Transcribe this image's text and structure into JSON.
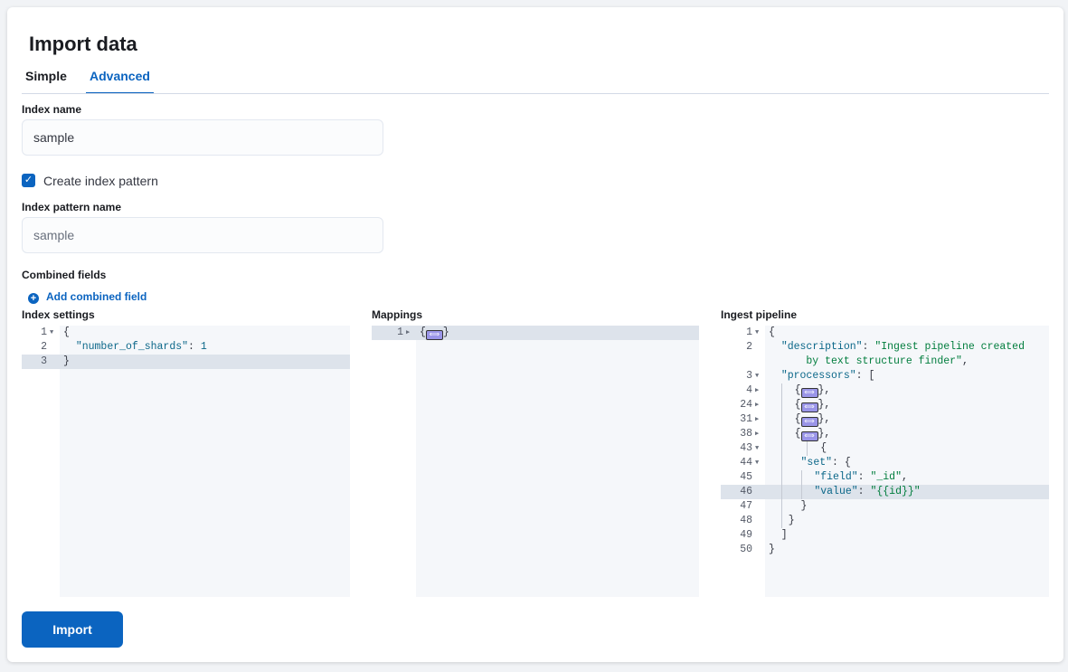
{
  "title": "Import data",
  "tabs": [
    {
      "label": "Simple",
      "active": false
    },
    {
      "label": "Advanced",
      "active": true
    }
  ],
  "index_name": {
    "label": "Index name",
    "value": "sample"
  },
  "create_index_pattern": {
    "label": "Create index pattern",
    "checked": true
  },
  "index_pattern_name": {
    "label": "Index pattern name",
    "value": "sample"
  },
  "combined_fields": {
    "label": "Combined fields",
    "add_label": "Add combined field"
  },
  "editors": [
    {
      "label": "Index settings",
      "lines": [
        {
          "n": "1",
          "fold": "open",
          "c": [
            [
              "p",
              "{"
            ]
          ]
        },
        {
          "n": "2",
          "c": [
            [
              "p",
              "  "
            ],
            [
              "k",
              "\"number_of_shards\""
            ],
            [
              "p",
              ": "
            ],
            [
              "n",
              "1"
            ]
          ]
        },
        {
          "n": "3",
          "hl": true,
          "c": [
            [
              "p",
              "}"
            ]
          ]
        }
      ]
    },
    {
      "label": "Mappings",
      "lines": [
        {
          "n": "1",
          "fold": "closed",
          "hl": true,
          "c": [
            [
              "p",
              "{"
            ],
            [
              "fw",
              ""
            ],
            [
              "p",
              "}"
            ]
          ]
        }
      ]
    },
    {
      "label": "Ingest pipeline",
      "lines": [
        {
          "n": "1",
          "fold": "open",
          "c": [
            [
              "p",
              "{"
            ]
          ]
        },
        {
          "n": "2",
          "c": [
            [
              "p",
              "  "
            ],
            [
              "k",
              "\"description\""
            ],
            [
              "p",
              ": "
            ],
            [
              "s",
              "\"Ingest pipeline created"
            ]
          ]
        },
        {
          "n": "",
          "c": [
            [
              "s",
              "      by text structure finder\""
            ],
            [
              "p",
              ","
            ]
          ]
        },
        {
          "n": "3",
          "fold": "open",
          "c": [
            [
              "p",
              "  "
            ],
            [
              "k",
              "\"processors\""
            ],
            [
              "p",
              ": ["
            ]
          ]
        },
        {
          "n": "4",
          "fold": "closed",
          "c": [
            [
              "p",
              "  "
            ],
            [
              "g",
              ""
            ],
            [
              "p",
              "  {"
            ],
            [
              "fw",
              ""
            ],
            [
              "p",
              "},"
            ]
          ]
        },
        {
          "n": "24",
          "fold": "closed",
          "c": [
            [
              "p",
              "  "
            ],
            [
              "g",
              ""
            ],
            [
              "p",
              "  {"
            ],
            [
              "fw",
              ""
            ],
            [
              "p",
              "},"
            ]
          ]
        },
        {
          "n": "31",
          "fold": "closed",
          "c": [
            [
              "p",
              "  "
            ],
            [
              "g",
              ""
            ],
            [
              "p",
              "  {"
            ],
            [
              "fw",
              ""
            ],
            [
              "p",
              "},"
            ]
          ]
        },
        {
          "n": "38",
          "fold": "closed",
          "c": [
            [
              "p",
              "  "
            ],
            [
              "g",
              ""
            ],
            [
              "p",
              "  {"
            ],
            [
              "fw",
              ""
            ],
            [
              "p",
              "},"
            ]
          ]
        },
        {
          "n": "43",
          "fold": "open",
          "c": [
            [
              "p",
              "  "
            ],
            [
              "g",
              ""
            ],
            [
              "p",
              "    "
            ],
            [
              "g",
              ""
            ],
            [
              "p",
              "  {"
            ]
          ]
        },
        {
          "n": "44",
          "fold": "open",
          "c": [
            [
              "p",
              "  "
            ],
            [
              "g",
              ""
            ],
            [
              "p",
              "   "
            ],
            [
              "k",
              "\"set\""
            ],
            [
              "p",
              ": {"
            ]
          ]
        },
        {
          "n": "45",
          "c": [
            [
              "p",
              "  "
            ],
            [
              "g",
              ""
            ],
            [
              "p",
              "   "
            ],
            [
              "g",
              ""
            ],
            [
              "p",
              "  "
            ],
            [
              "k",
              "\"field\""
            ],
            [
              "p",
              ": "
            ],
            [
              "s",
              "\"_id\""
            ],
            [
              "p",
              ","
            ]
          ]
        },
        {
          "n": "46",
          "hl": true,
          "c": [
            [
              "p",
              "  "
            ],
            [
              "g",
              ""
            ],
            [
              "p",
              "   "
            ],
            [
              "g",
              ""
            ],
            [
              "p",
              "  "
            ],
            [
              "k",
              "\"value\""
            ],
            [
              "p",
              ": "
            ],
            [
              "s",
              "\"{{id}}\""
            ]
          ]
        },
        {
          "n": "47",
          "c": [
            [
              "p",
              "  "
            ],
            [
              "g",
              ""
            ],
            [
              "p",
              "   }"
            ]
          ]
        },
        {
          "n": "48",
          "c": [
            [
              "p",
              "  "
            ],
            [
              "g",
              ""
            ],
            [
              "p",
              " }"
            ]
          ]
        },
        {
          "n": "49",
          "c": [
            [
              "p",
              "  ]"
            ]
          ]
        },
        {
          "n": "50",
          "c": [
            [
              "p",
              "}"
            ]
          ]
        }
      ]
    }
  ],
  "import_button": "Import",
  "colors": {
    "accent": "#0b64c0",
    "key": "#0b6789",
    "string": "#017d3d"
  }
}
